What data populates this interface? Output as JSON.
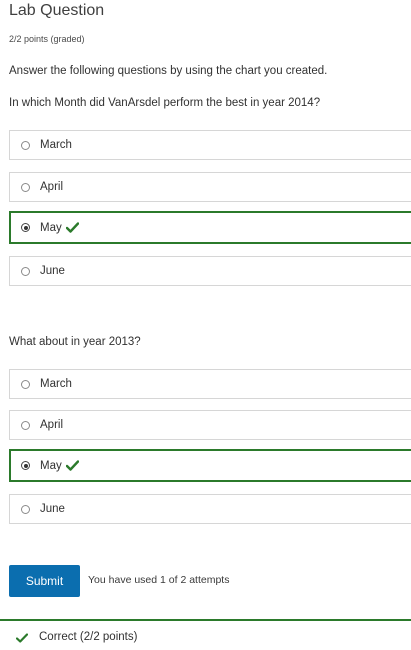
{
  "header": {
    "title": "Lab Question",
    "points": "2/2 points (graded)"
  },
  "instructions": "Answer the following questions by using the chart you created.",
  "questions": [
    {
      "prompt": "In which Month did VanArsdel perform the best in year 2014?",
      "options": [
        {
          "label": "March",
          "selected": false
        },
        {
          "label": "April",
          "selected": false
        },
        {
          "label": "May",
          "selected": true,
          "correct": true
        },
        {
          "label": "June",
          "selected": false
        }
      ]
    },
    {
      "prompt": "What about in year 2013?",
      "options": [
        {
          "label": "March",
          "selected": false
        },
        {
          "label": "April",
          "selected": false
        },
        {
          "label": "May",
          "selected": true,
          "correct": true
        },
        {
          "label": "June",
          "selected": false
        }
      ]
    }
  ],
  "actions": {
    "submit_label": "Submit",
    "attempts_text": "You have used 1 of 2 attempts"
  },
  "result": {
    "text": "Correct (2/2 points)",
    "icon": "checkmark-icon"
  },
  "colors": {
    "accent_green": "#2b7a2b",
    "submit_blue": "#0b6eaf",
    "border_gray": "#d6d6d6"
  }
}
